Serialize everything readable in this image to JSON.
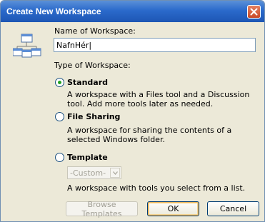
{
  "window": {
    "title": "Create New Workspace",
    "close_icon": "close-icon"
  },
  "form": {
    "name_label": "Name of Workspace:",
    "name_value": "NafnHér|",
    "type_label": "Type of Workspace:",
    "options": [
      {
        "label": "Standard",
        "selected": true,
        "description": "A workspace with a Files tool and a Discussion tool.  Add more tools later as needed."
      },
      {
        "label": "File Sharing",
        "selected": false,
        "description": "A workspace for sharing the contents of a selected Windows folder."
      },
      {
        "label": "Template",
        "selected": false,
        "description": "A workspace with tools you select from a list."
      }
    ],
    "template_select": {
      "value": "-Custom-",
      "disabled": true
    }
  },
  "buttons": {
    "browse": "Browse Templates",
    "ok": "OK",
    "cancel": "Cancel"
  },
  "colors": {
    "titlebar": "#2b6acb",
    "dialog_bg": "#ece9d8",
    "radio_dot": "#21a121"
  }
}
